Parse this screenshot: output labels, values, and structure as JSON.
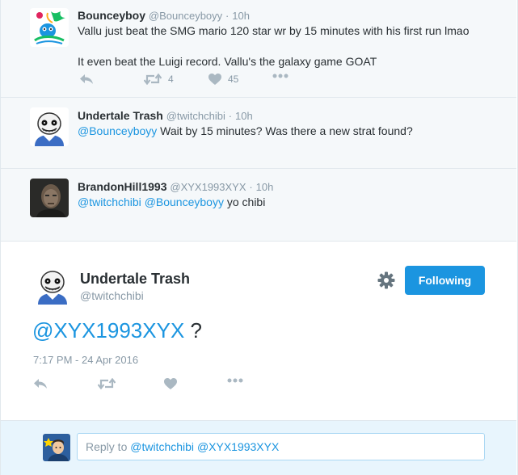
{
  "context_tweets": [
    {
      "fullname": "Bounceyboy",
      "handle": "@Bounceyboyy",
      "time": "10h",
      "line1": "Vallu just beat the SMG mario 120 star wr by 15 minutes with his first run lmao",
      "line2": "It even beat the Luigi record. Vallu's the galaxy game GOAT",
      "retweet_count": "4",
      "like_count": "45"
    },
    {
      "fullname": "Undertale Trash",
      "handle": "@twitchchibi",
      "time": "10h",
      "mention": "@Bounceyboyy",
      "text": " Wait by 15 minutes? Was there a new strat found?"
    },
    {
      "fullname": "BrandonHill1993",
      "handle": "@XYX1993XYX",
      "time": "10h",
      "mention1": "@twitchchibi",
      "mention2": "@Bounceyboyy",
      "text": " yo chibi"
    }
  ],
  "main_tweet": {
    "fullname": "Undertale Trash",
    "handle": "@twitchchibi",
    "follow_label": "Following",
    "mention": "@XYX1993XYX",
    "text": " ?",
    "timestamp": "7:17 PM - 24 Apr 2016"
  },
  "reply": {
    "prefix": "Reply to ",
    "mention1": "@twitchchibi",
    "mention2": "@XYX1993XYX"
  },
  "separator": "·",
  "colors": {
    "link": "#1b95e0",
    "context_bg": "#f5f8fa",
    "reply_bg": "#e8f5fd",
    "button": "#1b95e0",
    "icon": "#aab8c2"
  },
  "icons": [
    "reply-icon",
    "retweet-icon",
    "like-icon",
    "more-icon",
    "gear-icon"
  ]
}
